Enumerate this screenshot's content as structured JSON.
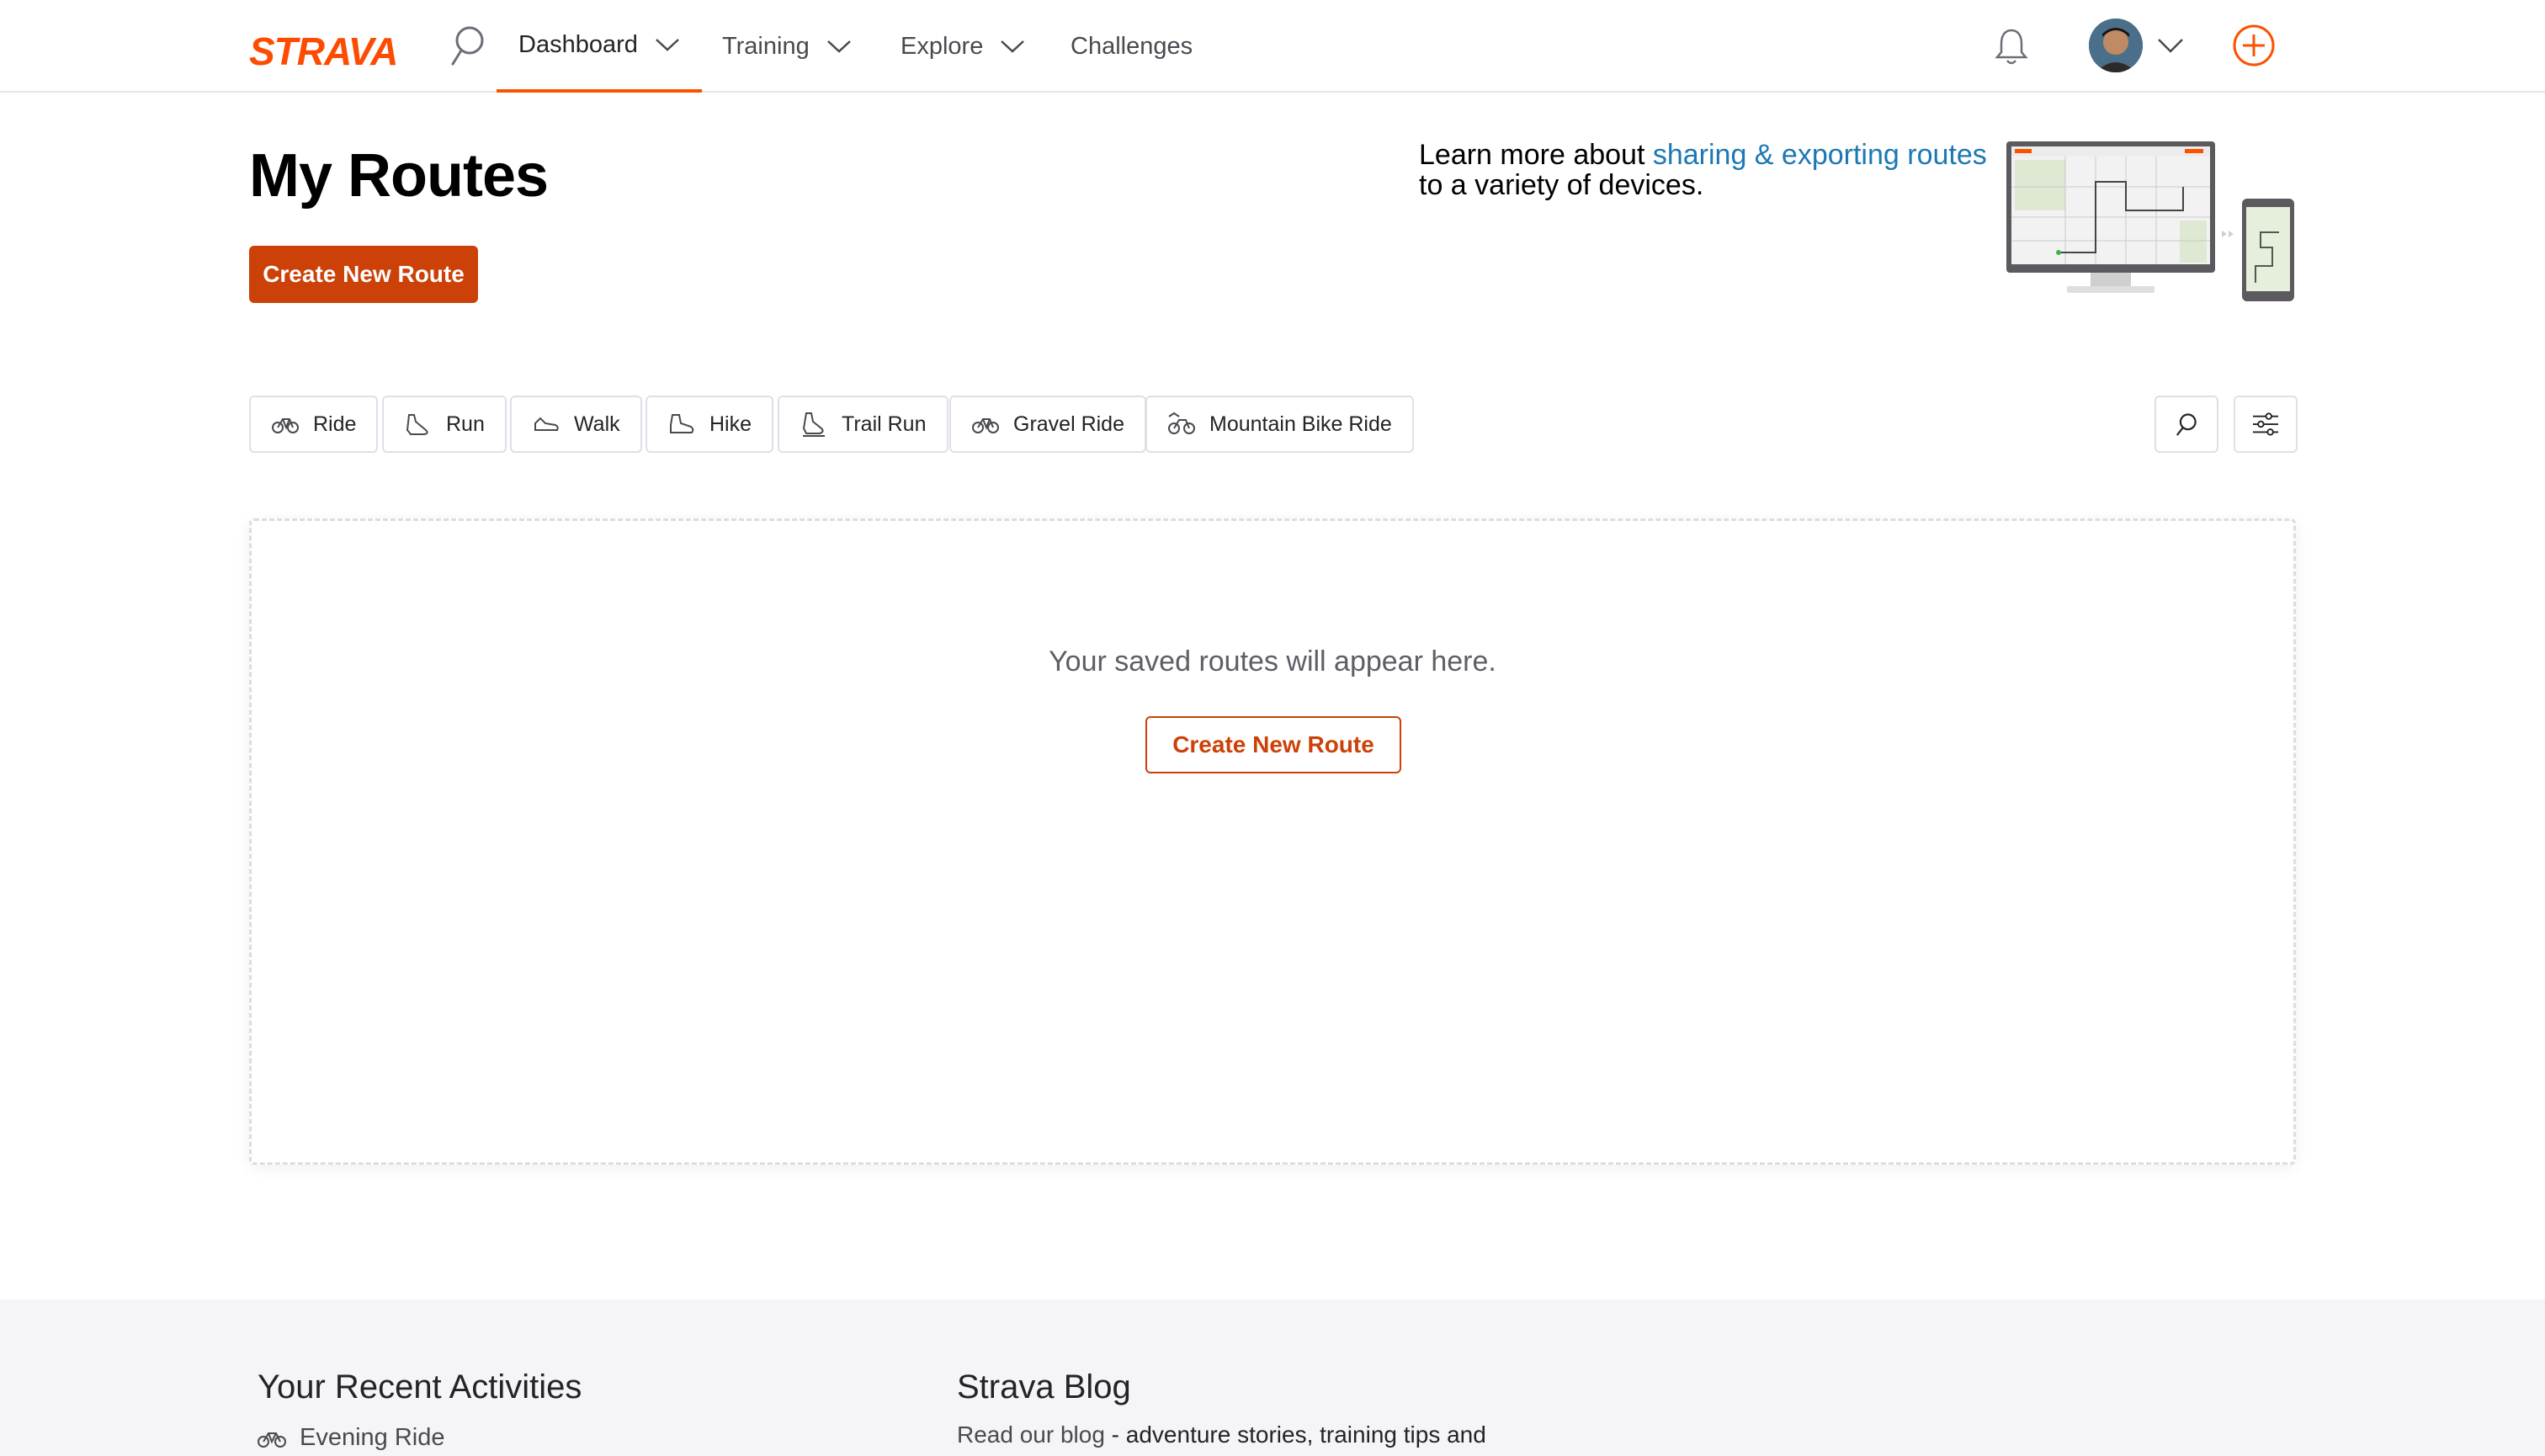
{
  "nav": {
    "logo": "STRAVA",
    "items": [
      {
        "label": "Dashboard",
        "active": true
      },
      {
        "label": "Training"
      },
      {
        "label": "Explore"
      },
      {
        "label": "Challenges"
      }
    ],
    "accent_color": "#fc5200"
  },
  "header": {
    "title": "My Routes",
    "create_button": "Create New Route",
    "learn_more_prefix": "Learn more about ",
    "learn_more_link": "sharing & exporting routes",
    "learn_more_suffix": "to a variety of devices."
  },
  "filters": {
    "chips": [
      {
        "label": "Ride",
        "icon": "bike-icon"
      },
      {
        "label": "Run",
        "icon": "shoe-icon"
      },
      {
        "label": "Walk",
        "icon": "walk-icon"
      },
      {
        "label": "Hike",
        "icon": "hike-icon"
      },
      {
        "label": "Trail Run",
        "icon": "trail-run-icon"
      },
      {
        "label": "Gravel Ride",
        "icon": "gravel-bike-icon"
      },
      {
        "label": "Mountain Bike Ride",
        "icon": "mountain-bike-icon"
      }
    ]
  },
  "panel": {
    "empty_message": "Your saved routes will appear here.",
    "create_button": "Create New Route"
  },
  "footer": {
    "recent_title": "Your Recent Activities",
    "recent_items": [
      {
        "label": "Evening Ride",
        "icon": "bike-icon"
      }
    ],
    "blog_title": "Strava Blog",
    "blog_link": "Read our blog",
    "blog_text": " - adventure stories, training tips and"
  },
  "colors": {
    "primary_button": "#cc4107",
    "link": "#1c78b4"
  }
}
